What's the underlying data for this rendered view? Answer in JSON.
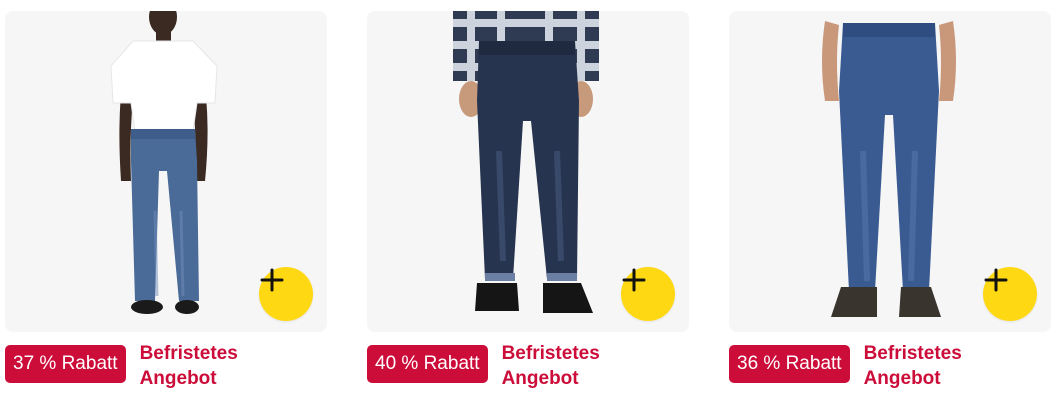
{
  "colors": {
    "badge_bg": "#cc0c39",
    "deal_text": "#cc0c39",
    "add_button": "#ffd814"
  },
  "products": [
    {
      "image": "man-white-tshirt-light-wash-jeans",
      "badge": "37 % Rabatt",
      "deal": "Befristetes Angebot",
      "button_icon": "plus-icon"
    },
    {
      "image": "man-plaid-shirt-dark-wash-jeans",
      "badge": "40 % Rabatt",
      "deal": "Befristetes Angebot",
      "button_icon": "plus-icon"
    },
    {
      "image": "man-medium-wash-jeans",
      "badge": "36 % Rabatt",
      "deal": "Befristetes Angebot",
      "button_icon": "plus-icon"
    }
  ]
}
